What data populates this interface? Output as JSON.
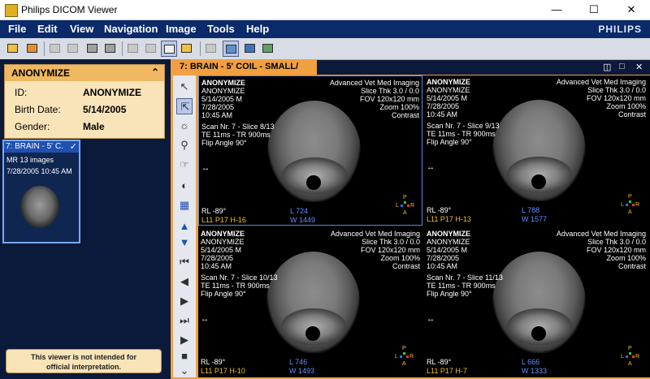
{
  "window": {
    "title": "Philips DICOM Viewer",
    "minimize": "—",
    "maximize": "☐",
    "close": "✕"
  },
  "menu": [
    "File",
    "Edit",
    "View",
    "Navigation",
    "Image",
    "Tools",
    "Help"
  ],
  "brand": "PHILIPS",
  "patient": {
    "name": "ANONYMIZE",
    "fields": [
      {
        "label": "ID:",
        "value": "ANONYMIZE"
      },
      {
        "label": "Birth Date:",
        "value": "5/14/2005"
      },
      {
        "label": "Gender:",
        "value": "Male"
      }
    ]
  },
  "series": {
    "title": "7: BRAIN - 5' C...",
    "count": "MR 13 images",
    "datetime": "7/28/2005 10:45 AM"
  },
  "disclaimer": {
    "line1": "This viewer is not intended for",
    "line2": "official interpretation."
  },
  "viewer": {
    "tab_title": "7: BRAIN - 5' COIL - SMALL/"
  },
  "viewports": [
    {
      "patient": "ANONYMIZE",
      "patient2": "ANONYMIZE",
      "birth": "5/14/2005   M",
      "study_date": "7/28/2005",
      "study_time": "10:45 AM",
      "institution": "Advanced Vet Med Imaging",
      "slice_thk": "Slice Thk 3.0 / 0.0",
      "fov": "FOV 120x120 mm",
      "zoom": "Zoom 100%",
      "contrast": "Contrast",
      "scan": "Scan Nr. 7 - Slice 8/13",
      "te_tr": "TE 11ms - TR 900ms",
      "flip": "Flip Angle 90°",
      "rl": "RL -89°",
      "pos": "L11 P17 H-16",
      "level": "L 724",
      "width": "W 1449"
    },
    {
      "patient": "ANONYMIZE",
      "patient2": "ANONYMIZE",
      "birth": "5/14/2005   M",
      "study_date": "7/28/2005",
      "study_time": "10:45 AM",
      "institution": "Advanced Vet Med Imaging",
      "slice_thk": "Slice Thk 3.0 / 0.0",
      "fov": "FOV 120x120 mm",
      "zoom": "Zoom 100%",
      "contrast": "Contrast",
      "scan": "Scan Nr. 7 - Slice 9/13",
      "te_tr": "TE 11ms - TR 900ms",
      "flip": "Flip Angle 90°",
      "rl": "RL -89°",
      "pos": "L11 P17 H-13",
      "level": "L 788",
      "width": "W 1577"
    },
    {
      "patient": "ANONYMIZE",
      "patient2": "ANONYMIZE",
      "birth": "5/14/2005   M",
      "study_date": "7/28/2005",
      "study_time": "10:45 AM",
      "institution": "Advanced Vet Med Imaging",
      "slice_thk": "Slice Thk 3.0 / 0.0",
      "fov": "FOV 120x120 mm",
      "zoom": "Zoom 100%",
      "contrast": "Contrast",
      "scan": "Scan Nr. 7 - Slice 10/13",
      "te_tr": "TE 11ms - TR 900ms",
      "flip": "Flip Angle 90°",
      "rl": "RL -89°",
      "pos": "L11 P17 H-10",
      "level": "L 746",
      "width": "W 1493"
    },
    {
      "patient": "ANONYMIZE",
      "patient2": "ANONYMIZE",
      "birth": "5/14/2005   M",
      "study_date": "7/28/2005",
      "study_time": "10:45 AM",
      "institution": "Advanced Vet Med Imaging",
      "slice_thk": "Slice Thk 3.0 / 0.0",
      "fov": "FOV 120x120 mm",
      "zoom": "Zoom 100%",
      "contrast": "Contrast",
      "scan": "Scan Nr. 7 - Slice 11/13",
      "te_tr": "TE 11ms - TR 900ms",
      "flip": "Flip Angle 90°",
      "rl": "RL -89°",
      "pos": "L11 P17 H-7",
      "level": "L 666",
      "width": "W 1333"
    }
  ],
  "orientation_labels": {
    "top": "P",
    "left": "L",
    "right": "R",
    "bottom": "A"
  },
  "colors": {
    "menubar": "#0a2a6a",
    "accent_orange": "#f0a040",
    "patient_card": "#f8e4b8",
    "overlay_blue": "#6090ff"
  }
}
